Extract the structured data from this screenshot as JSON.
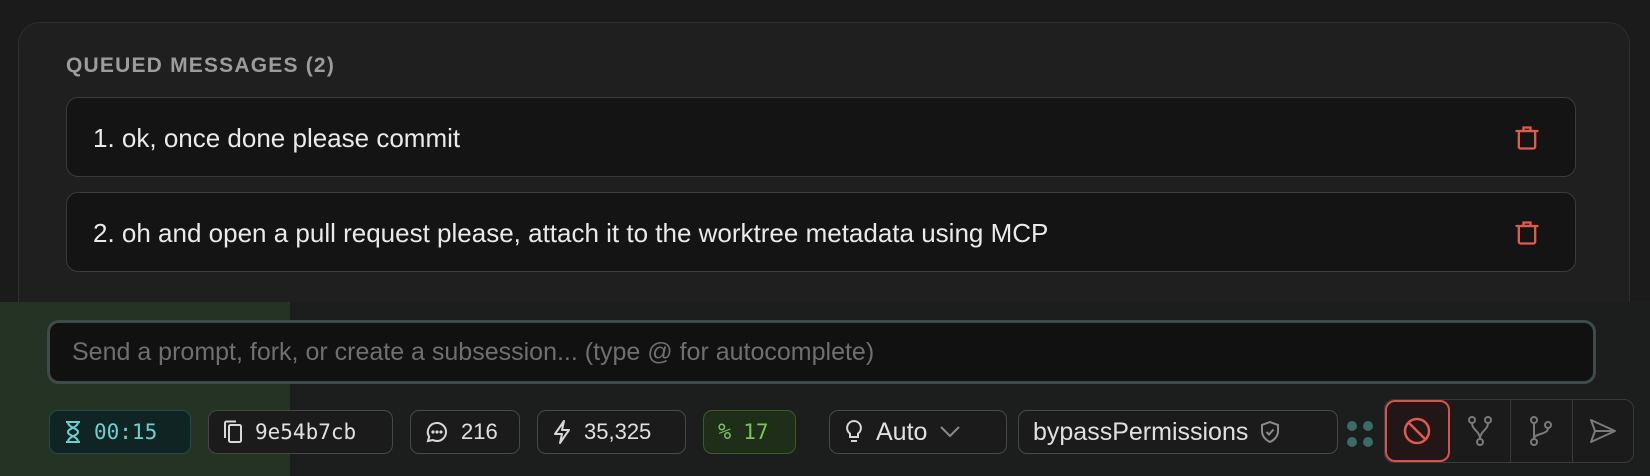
{
  "queue": {
    "title": "QUEUED MESSAGES (2)",
    "items": [
      {
        "text": "1. ok, once done please commit"
      },
      {
        "text": "2. oh and open a pull request please, attach it to the worktree metadata using MCP"
      }
    ]
  },
  "prompt": {
    "placeholder": "Send a prompt, fork, or create a subsession... (type @ for autocomplete)",
    "value": ""
  },
  "status": {
    "timer": "00:15",
    "commit": "9e54b7cb",
    "messages": "216",
    "tokens": "35,325",
    "percent": "17"
  },
  "mode": {
    "thinking": "Auto",
    "permission": "bypassPermissions"
  },
  "icons": {
    "timer": "hourglass-icon",
    "commit": "copy-icon",
    "messages": "chat-bubble-icon",
    "tokens": "lightning-icon",
    "percent": "percent-icon",
    "thinking": "lightbulb-icon",
    "permission": "shield-icon",
    "delete": "trash-icon",
    "stop": "stop-icon",
    "fork": "fork-icon",
    "subsession": "branch-icon",
    "send": "send-icon"
  },
  "colors": {
    "accent_teal": "#6ad1d1",
    "accent_green": "#79c45a",
    "danger": "#d9524c"
  }
}
